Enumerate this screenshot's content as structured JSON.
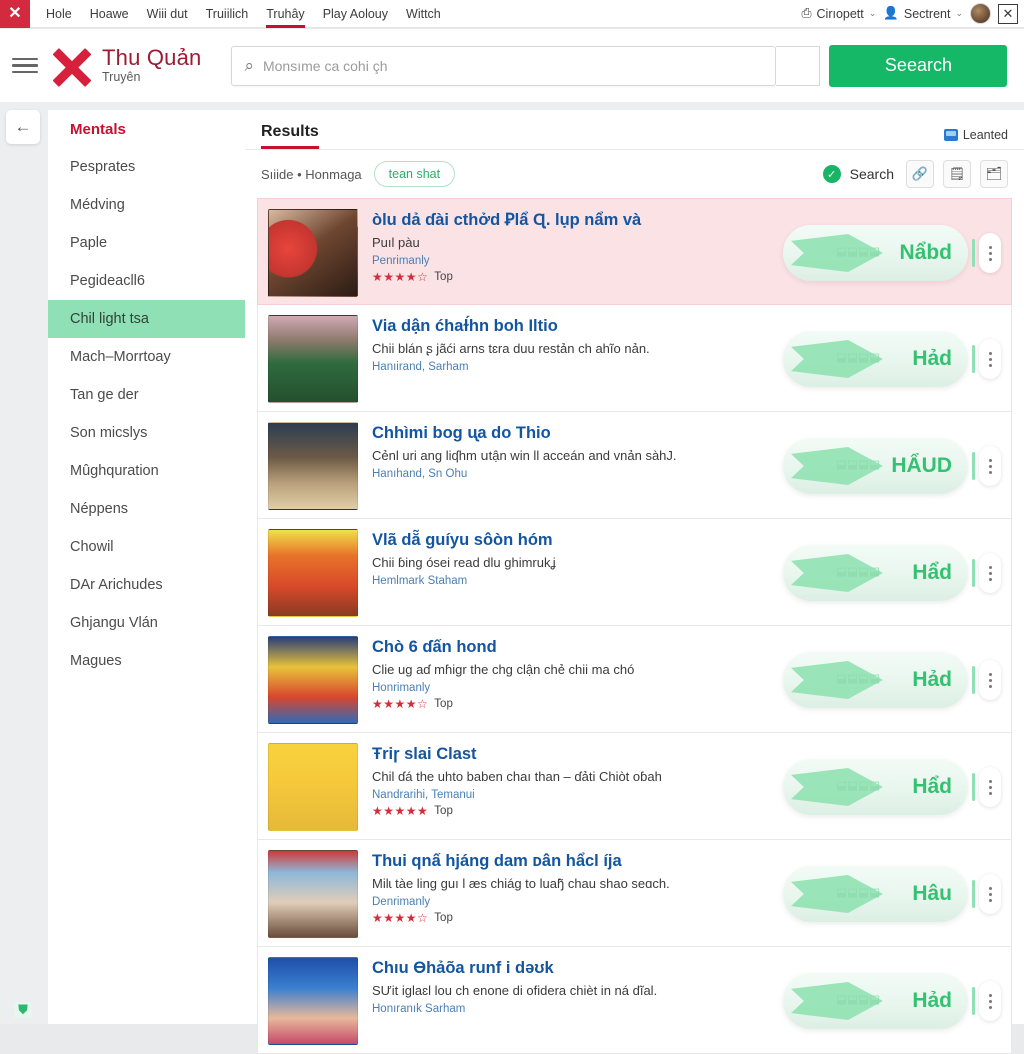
{
  "topbar": {
    "logo_glyph": "✕",
    "nav": [
      {
        "label": "Hole",
        "active": false
      },
      {
        "label": "Hoawe",
        "active": false
      },
      {
        "label": "Wiii dut",
        "active": false
      },
      {
        "label": "Truiilich",
        "active": false
      },
      {
        "label": "Truhây",
        "active": true
      },
      {
        "label": "Play Aolouy",
        "active": false
      },
      {
        "label": "Wittch",
        "active": false
      }
    ],
    "right": {
      "upload_label": "Cirıopett",
      "account_label": "Sectrent",
      "caret": "⌄",
      "close_glyph": "✕"
    }
  },
  "header": {
    "brand_title": "Thu Quản",
    "brand_subtitle": "Truyên",
    "search_placeholder": "Monsıme ca cohi çh",
    "search_value": "",
    "search_icon": "⌕",
    "search_button": "Seearch"
  },
  "sidebar": {
    "back_glyph": "←",
    "items": [
      {
        "label": "Mentals",
        "head": true,
        "selected": false
      },
      {
        "label": "Pesprates",
        "head": false,
        "selected": false
      },
      {
        "label": "Médving",
        "head": false,
        "selected": false
      },
      {
        "label": "Paple",
        "head": false,
        "selected": false
      },
      {
        "label": "Pegideacll6",
        "head": false,
        "selected": false
      },
      {
        "label": "Chil light tsa",
        "head": false,
        "selected": true
      },
      {
        "label": "Mach–Morrtoay",
        "head": false,
        "selected": false
      },
      {
        "label": "Tan ge der",
        "head": false,
        "selected": false
      },
      {
        "label": "Son micslys",
        "head": false,
        "selected": false
      },
      {
        "label": "Mûghquration",
        "head": false,
        "selected": false
      },
      {
        "label": "Néppens",
        "head": false,
        "selected": false
      },
      {
        "label": "Chowil",
        "head": false,
        "selected": false
      },
      {
        "label": "DAr Arichudes",
        "head": false,
        "selected": false
      },
      {
        "label": "Ghjangu Vlán",
        "head": false,
        "selected": false
      },
      {
        "label": "Magues",
        "head": false,
        "selected": false
      }
    ]
  },
  "results": {
    "title": "Results",
    "badge_label": "Leanted",
    "breadcrumb": "Sıiide • Honmaga",
    "chip": "tean shat",
    "search_label": "Search",
    "check_glyph": "✓",
    "tool_icons": [
      "link-icon",
      "clipboard-image-icon",
      "folder-icon"
    ],
    "tool_glyphs": [
      "🔗",
      "🗒",
      "🗂"
    ],
    "rows": [
      {
        "title": "òlu dả ɗài cthởd Ꝑlẩ Ɋ. lụp nẩm và",
        "subtitle": "Puıl pàu",
        "meta": "Penrimanly",
        "stars": 4,
        "stars_label": "Top",
        "pill_value": "Nẩbd",
        "pill_ghost": "⬓⬓⬓⬓",
        "highlighted": true,
        "thumb": "red-puppet-man-sunglasses"
      },
      {
        "title": "Via dận ćhaɫ́hn boh Iltio",
        "subtitle": "Chii blán ʂ jãći arns tɛra duu restản ch ahĩo nản.",
        "meta": "Hanıirand, Sarham",
        "stars": 0,
        "stars_label": "",
        "pill_value": "Hảd",
        "pill_ghost": "⬓⬓⬓⬓",
        "highlighted": false,
        "thumb": "woman-green-dress"
      },
      {
        "title": "Chhìmi bog ᶙa do Thio",
        "subtitle": "Cẻnl uri ang liʠhm սtận win ll acceán and vnản sàhJ.",
        "meta": "Hanıhand, Sn Ohu",
        "stars": 0,
        "stars_label": "",
        "pill_value": "HẨUD",
        "pill_ghost": "⬓⬓⬓⬓",
        "highlighted": false,
        "thumb": "animated-animals-cereal"
      },
      {
        "title": "Vlã dẵ guíyu sôòn hóm",
        "subtitle": "Chii ɓing ósei read dlu ghimrukʝ",
        "meta": "Hemlmark Staham",
        "stars": 0,
        "stars_label": "",
        "pill_value": "Hẩd",
        "pill_ghost": "⬓⬓⬓⬓",
        "highlighted": false,
        "thumb": "lode-con-orange-comic"
      },
      {
        "title": "Chò 6 ɗấn hond",
        "subtitle": "Clie ug aɗ mɦiɡr the chg clận chẻ chii ma chó",
        "meta": "Honrimanly",
        "stars": 4,
        "stars_label": "Top",
        "pill_value": "Hảd",
        "pill_ghost": "⬓⬓⬓⬓",
        "highlighted": false,
        "thumb": "hugh-heroes-poster"
      },
      {
        "title": "Ŧriɼ slai Clast",
        "subtitle": "Chil ɗá the uhto baben chaı than – ɗảti Chiòt oɓah",
        "meta": "Nandrarihi, Temanui",
        "stars": 5,
        "stars_label": "Top",
        "pill_value": "Hẩd",
        "pill_ghost": "⬓⬓⬓⬓",
        "highlighted": false,
        "thumb": "yellow-family-anime"
      },
      {
        "title": "Thui qnấ hjáng dam ᴅân hẩcl íja",
        "subtitle": "Milɩ tàe ling ɡuı l æs chiáɡ to luaɧ̃ chau shao seɑch.",
        "meta": "Denrimanly",
        "stars": 4,
        "stars_label": "Top",
        "pill_value": "Hâu",
        "pill_ghost": "⬓⬓⬓⬓",
        "highlighted": false,
        "thumb": "doctor-couple-illustration"
      },
      {
        "title": "Chıu Ɵhảõa runf i dəʊk",
        "subtitle": "SƯit iglaɛl lou ch enone di ofidera chièt in ná dĩal.",
        "meta": "Honıranık Sarham",
        "stars": 0,
        "stars_label": "",
        "pill_value": "Hảd",
        "pill_ghost": "⬓⬓⬓⬓",
        "highlighted": false,
        "thumb": "blue-group-kids-comic"
      }
    ]
  },
  "footer": {
    "corner_icon_glyph": "⛊"
  },
  "colors": {
    "brand_red": "#c8102e",
    "accent_green": "#14b866",
    "link_blue": "#1455a0",
    "highlight_pink": "#fbe2e5",
    "selected_green": "#8fe0b5"
  }
}
